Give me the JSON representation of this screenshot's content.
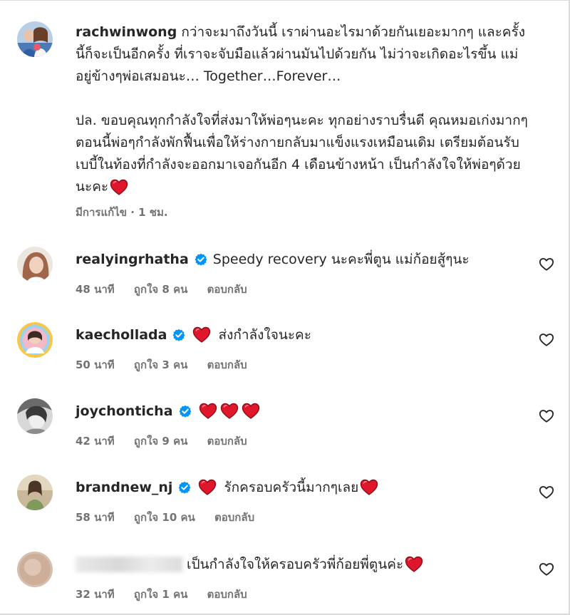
{
  "colors": {
    "text": "#262626",
    "secondary": "#737373",
    "verified": "#0095f6",
    "heart": "#e0172c"
  },
  "caption": {
    "username": "rachwinwong",
    "paragraph1": "กว่าจะมาถึงวันนี้ เราผ่านอะไรมาด้วยกันเยอะมากๆ และครั้งนี้ก็จะเป็นอีกครั้ง ที่เราจะจับมือแล้วผ่านมันไปด้วยกัน ไม่ว่าจะเกิดอะไรขึ้น แม่อยู่ข้างๆพ่อเสมอนะ… Together…Forever…",
    "paragraph2": "ปล. ขอบคุณทุกกำลังใจที่ส่งมาให้พ่อๆนะคะ ทุกอย่างราบรื่นดี คุณหมอเก่งมากๆ ตอนนี้พ่อๆกำลังพักฟื้นเพื่อให้ร่างกายกลับมาแข็งแรงเหมือนเดิม เตรียมต้อนรับเบบี้ในท้องที่กำลังจะออกมาเจอกันอีก 4 เดือนข้างหน้า เป็นกำลังใจให้พ่อๆด้วยนะคะ",
    "meta": "มีการแก้ไข · 1 ชม."
  },
  "comments": [
    {
      "username": "realyingrhatha",
      "text": "Speedy recovery นะคะพี่ตูน แม่ก้อยสู้ๆนะ",
      "time": "48 นาที",
      "likes": "ถูกใจ 8 คน",
      "reply": "ตอบกลับ"
    },
    {
      "username": "kaechollada",
      "text": "ส่งกำลังใจนะคะ",
      "time": "50 นาที",
      "likes": "ถูกใจ 3 คน",
      "reply": "ตอบกลับ"
    },
    {
      "username": "joychonticha",
      "text": "",
      "time": "42 นาที",
      "likes": "ถูกใจ 9 คน",
      "reply": "ตอบกลับ"
    },
    {
      "username": "brandnew_nj",
      "text": "รักครอบครัวนี้มากๆเลย",
      "time": "58 นาที",
      "likes": "ถูกใจ 10 คน",
      "reply": "ตอบกลับ"
    },
    {
      "username": "",
      "text": "เป็นกำลังใจให้ครอบครัวพี่ก้อยพี่ตูนค่ะ",
      "time": "32 นาที",
      "likes": "ถูกใจ 1 คน",
      "reply": "ตอบกลับ"
    }
  ],
  "icons": {
    "verified": "verified-badge-icon",
    "like": "heart-outline-icon",
    "emoji": "red-heart-emoji-icon"
  }
}
